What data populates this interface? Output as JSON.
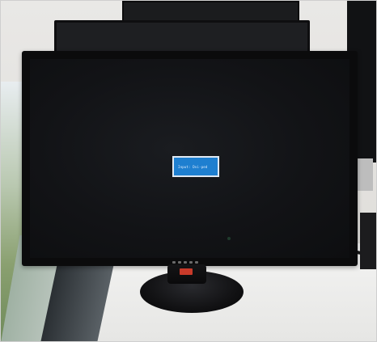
{
  "scene": {
    "description_tag": "desk-monitor-photo",
    "monitor_message": "Input: Dvi-ped",
    "accent_color": "#1e7fd0",
    "led_color": "#1f3b2c",
    "stand_logo_color": "#c83a2a"
  }
}
